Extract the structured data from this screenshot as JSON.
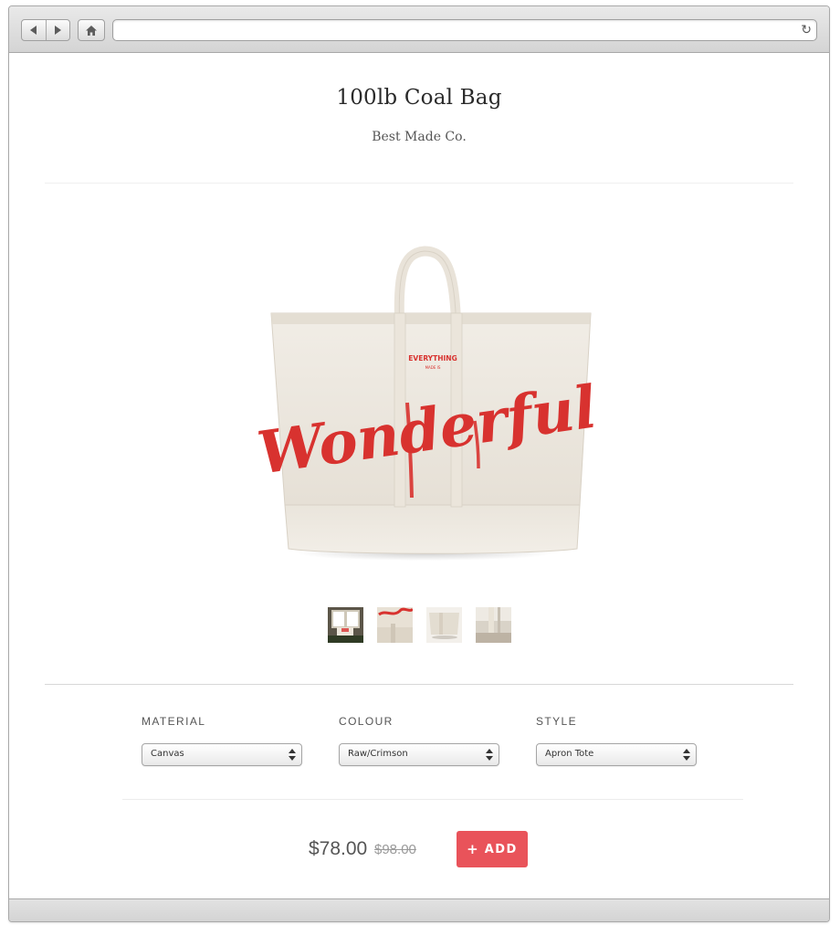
{
  "browser": {
    "back_icon": "triangle-left-icon",
    "forward_icon": "triangle-right-icon",
    "home_icon": "house-icon",
    "reload_icon": "reload-icon",
    "reload_glyph": "↻",
    "url": ""
  },
  "product": {
    "title": "100lb Coal Bag",
    "brand": "Best Made Co.",
    "image": {
      "bag_print": "Wonderful",
      "bag_print_top": "EVERYTHING",
      "bag_print_small": "MADE IS"
    },
    "thumbnails": [
      {
        "name": "thumb-1",
        "icon": "photo-window-scene"
      },
      {
        "name": "thumb-2",
        "icon": "photo-bag-print-closeup"
      },
      {
        "name": "thumb-3",
        "icon": "photo-bag-bottom"
      },
      {
        "name": "thumb-4",
        "icon": "photo-bag-handle"
      }
    ]
  },
  "options": [
    {
      "label": "MATERIAL",
      "value": "Canvas"
    },
    {
      "label": "COLOUR",
      "value": "Raw/Crimson"
    },
    {
      "label": "STYLE",
      "value": "Apron Tote"
    }
  ],
  "purchase": {
    "price": "$78.00",
    "original_price": "$98.00",
    "add_plus": "+",
    "add_label": "ADD"
  },
  "colors": {
    "accent": "#e9535a",
    "print_red": "#d8322f",
    "canvas": "#ece7df"
  }
}
